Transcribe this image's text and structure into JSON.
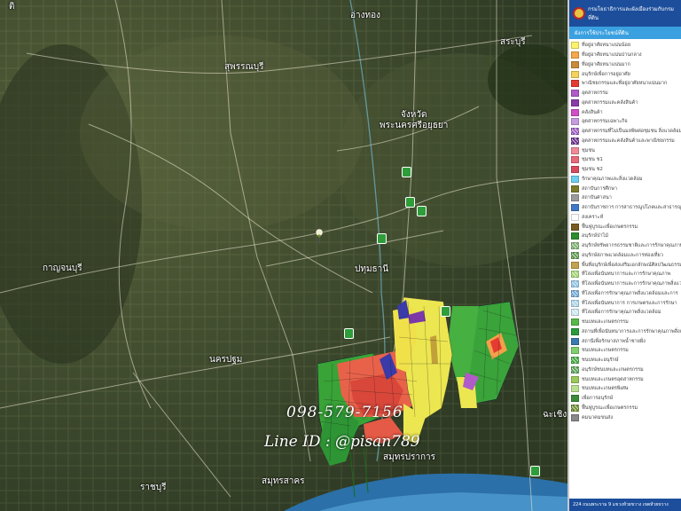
{
  "map": {
    "places": [
      {
        "id": "ang-thong",
        "label": "อ่างทอง"
      },
      {
        "id": "suphanburi",
        "label": "สุพรรณบุรี"
      },
      {
        "id": "saraburi",
        "label": "สระบุรี"
      },
      {
        "id": "ayutthaya-1",
        "label": "จังหวัด"
      },
      {
        "id": "ayutthaya-2",
        "label": "พระนครศรีอยุธยา"
      },
      {
        "id": "kanchanaburi",
        "label": "กาญจนบุรี"
      },
      {
        "id": "pathum-thani",
        "label": "ปทุมธานี"
      },
      {
        "id": "nakhon-pathom",
        "label": "นครปฐม"
      },
      {
        "id": "samut-prakan",
        "label": "สมุทรปราการ"
      },
      {
        "id": "samut-sakhon",
        "label": "สมุทรสาคร"
      },
      {
        "id": "ratchaburi",
        "label": "ราชบุรี"
      },
      {
        "id": "chachoengsao",
        "label": "ฉะเชิง"
      }
    ],
    "watermark": {
      "phone": "098-579-7156",
      "line": "Line ID : @pisan789"
    }
  },
  "legend": {
    "header": "กรมโยธาธิการและผังเมืองร่วมกับกรมที่ดิน",
    "subheader": "ผังการใช้ประโยชน์ที่ดิน",
    "items": [
      {
        "label": "ที่อยู่อาศัยหนาแน่นน้อย",
        "color": "#fff36b",
        "hatch": false
      },
      {
        "label": "ที่อยู่อาศัยหนาแน่นปานกลาง",
        "color": "#f6a74a",
        "hatch": false
      },
      {
        "label": "ที่อยู่อาศัยหนาแน่นมาก",
        "color": "#c98b3a",
        "hatch": false
      },
      {
        "label": "อนุรักษ์เพื่อการอยู่อาศัย",
        "color": "#f5d25a",
        "hatch": false
      },
      {
        "label": "พาณิชยกรรมและที่อยู่อาศัยหนาแน่นมาก",
        "color": "#e53b30",
        "hatch": false
      },
      {
        "label": "อุตสาหกรรม",
        "color": "#b05cc8",
        "hatch": false
      },
      {
        "label": "อุตสาหกรรมและคลังสินค้า",
        "color": "#8a3ca8",
        "hatch": false
      },
      {
        "label": "คลังสินค้า",
        "color": "#d24fc8",
        "hatch": false
      },
      {
        "label": "อุตสาหกรรมเฉพาะกิจ",
        "color": "#c79be0",
        "hatch": false
      },
      {
        "label": "อุตสาหกรรมที่ไม่เป็นมลพิษต่อชุมชน สิ่งแวดล้อม",
        "color": "#9c58c4",
        "hatch": true
      },
      {
        "label": "อุตสาหกรรมและคลังสินค้าและพาณิชยกรรม",
        "color": "#6a2c8c",
        "hatch": true
      },
      {
        "label": "ชุมชน",
        "color": "#f08a96",
        "hatch": false
      },
      {
        "label": "ชุมชน ช1",
        "color": "#e86a7a",
        "hatch": false
      },
      {
        "label": "ชุมชน ช2",
        "color": "#d94a5e",
        "hatch": false
      },
      {
        "label": "รักษาคุณภาพและสิ่งแวดล้อม",
        "color": "#6ccff0",
        "hatch": false
      },
      {
        "label": "สถาบันการศึกษา",
        "color": "#7a7a2a",
        "hatch": false
      },
      {
        "label": "สถาบันศาสนา",
        "color": "#9a9a9a",
        "hatch": false
      },
      {
        "label": "สถาบันราชการ การสาธารณูปโภคและสาธารณูปการ",
        "color": "#3f78c6",
        "hatch": false
      },
      {
        "label": "สงเคราะห์",
        "color": "#ffffff",
        "hatch": false
      },
      {
        "label": "ฟื้นฟูบูรณะเพื่อเกษตรกรรม",
        "color": "#7a5a20",
        "hatch": false
      },
      {
        "label": "อนุรักษ์ป่าไม้",
        "color": "#2e8b2e",
        "hatch": false
      },
      {
        "label": "อนุรักษ์ทรัพยากรธรรมชาติและการรักษาคุณภาพ",
        "color": "#7ab06a",
        "hatch": true
      },
      {
        "label": "อนุรักษ์สภาพแวดล้อมและการท่องเที่ยว",
        "color": "#5a9a4a",
        "hatch": true
      },
      {
        "label": "พื้นที่อนุรักษ์เพื่อส่งเสริมเอกลักษณ์ศิลปวัฒนธรรม",
        "color": "#c3a24e",
        "hatch": false
      },
      {
        "label": "ที่โล่งเพื่อนันทนาการและการรักษาคุณภาพ",
        "color": "#9fd46c",
        "hatch": true
      },
      {
        "label": "ที่โล่งเพื่อนันทนาการและการรักษาคุณภาพสิ่งแวดล้อม",
        "color": "#8cc3e6",
        "hatch": true
      },
      {
        "label": "ที่โล่งเพื่อการรักษาคุณภาพสิ่งแวดล้อมและการ",
        "color": "#6da9d6",
        "hatch": true
      },
      {
        "label": "ที่โล่งเพื่อนันทนาการ การเกษตรและการรักษา",
        "color": "#a8d4e8",
        "hatch": true
      },
      {
        "label": "ที่โล่งเพื่อการรักษาคุณภาพสิ่งแวดล้อม",
        "color": "#c8e6f2",
        "hatch": true
      },
      {
        "label": "ชนบทและเกษตรกรรม",
        "color": "#58b848",
        "hatch": false
      },
      {
        "label": "สถานที่เพื่อนันทนาการและการรักษาคุณภาพสิ่งแวดล้อม",
        "color": "#2a9a3a",
        "hatch": false
      },
      {
        "label": "สถานีเพื่อรักษาสภาพน้ำชายฝั่ง",
        "color": "#3a7ab0",
        "hatch": false
      },
      {
        "label": "ชนบทและเกษตรกรรม",
        "color": "#7fd06a",
        "hatch": false
      },
      {
        "label": "ชนบทและอนุรักษ์",
        "color": "#3da83a",
        "hatch": true
      },
      {
        "label": "อนุรักษ์ชนบทและเกษตรกรรม",
        "color": "#56a052",
        "hatch": true
      },
      {
        "label": "ชนบทและเกษตรอุตสาหกรรม",
        "color": "#9bc85a",
        "hatch": false
      },
      {
        "label": "ชนบทและเกษตรพิเศษ",
        "color": "#b8e090",
        "hatch": false
      },
      {
        "label": "เพื่อการอนุรักษ์",
        "color": "#3a8a3a",
        "hatch": false
      },
      {
        "label": "ฟื้นฟูบูรณะเพื่อเกษตรกรรม",
        "color": "#6a8a28",
        "hatch": true
      },
      {
        "label": "คมนาคมขนส่ง",
        "color": "#888888",
        "hatch": false
      }
    ],
    "footer": "224 ถนนพระราม 9 แขวงห้วยขวาง เขตห้วยขวาง"
  }
}
